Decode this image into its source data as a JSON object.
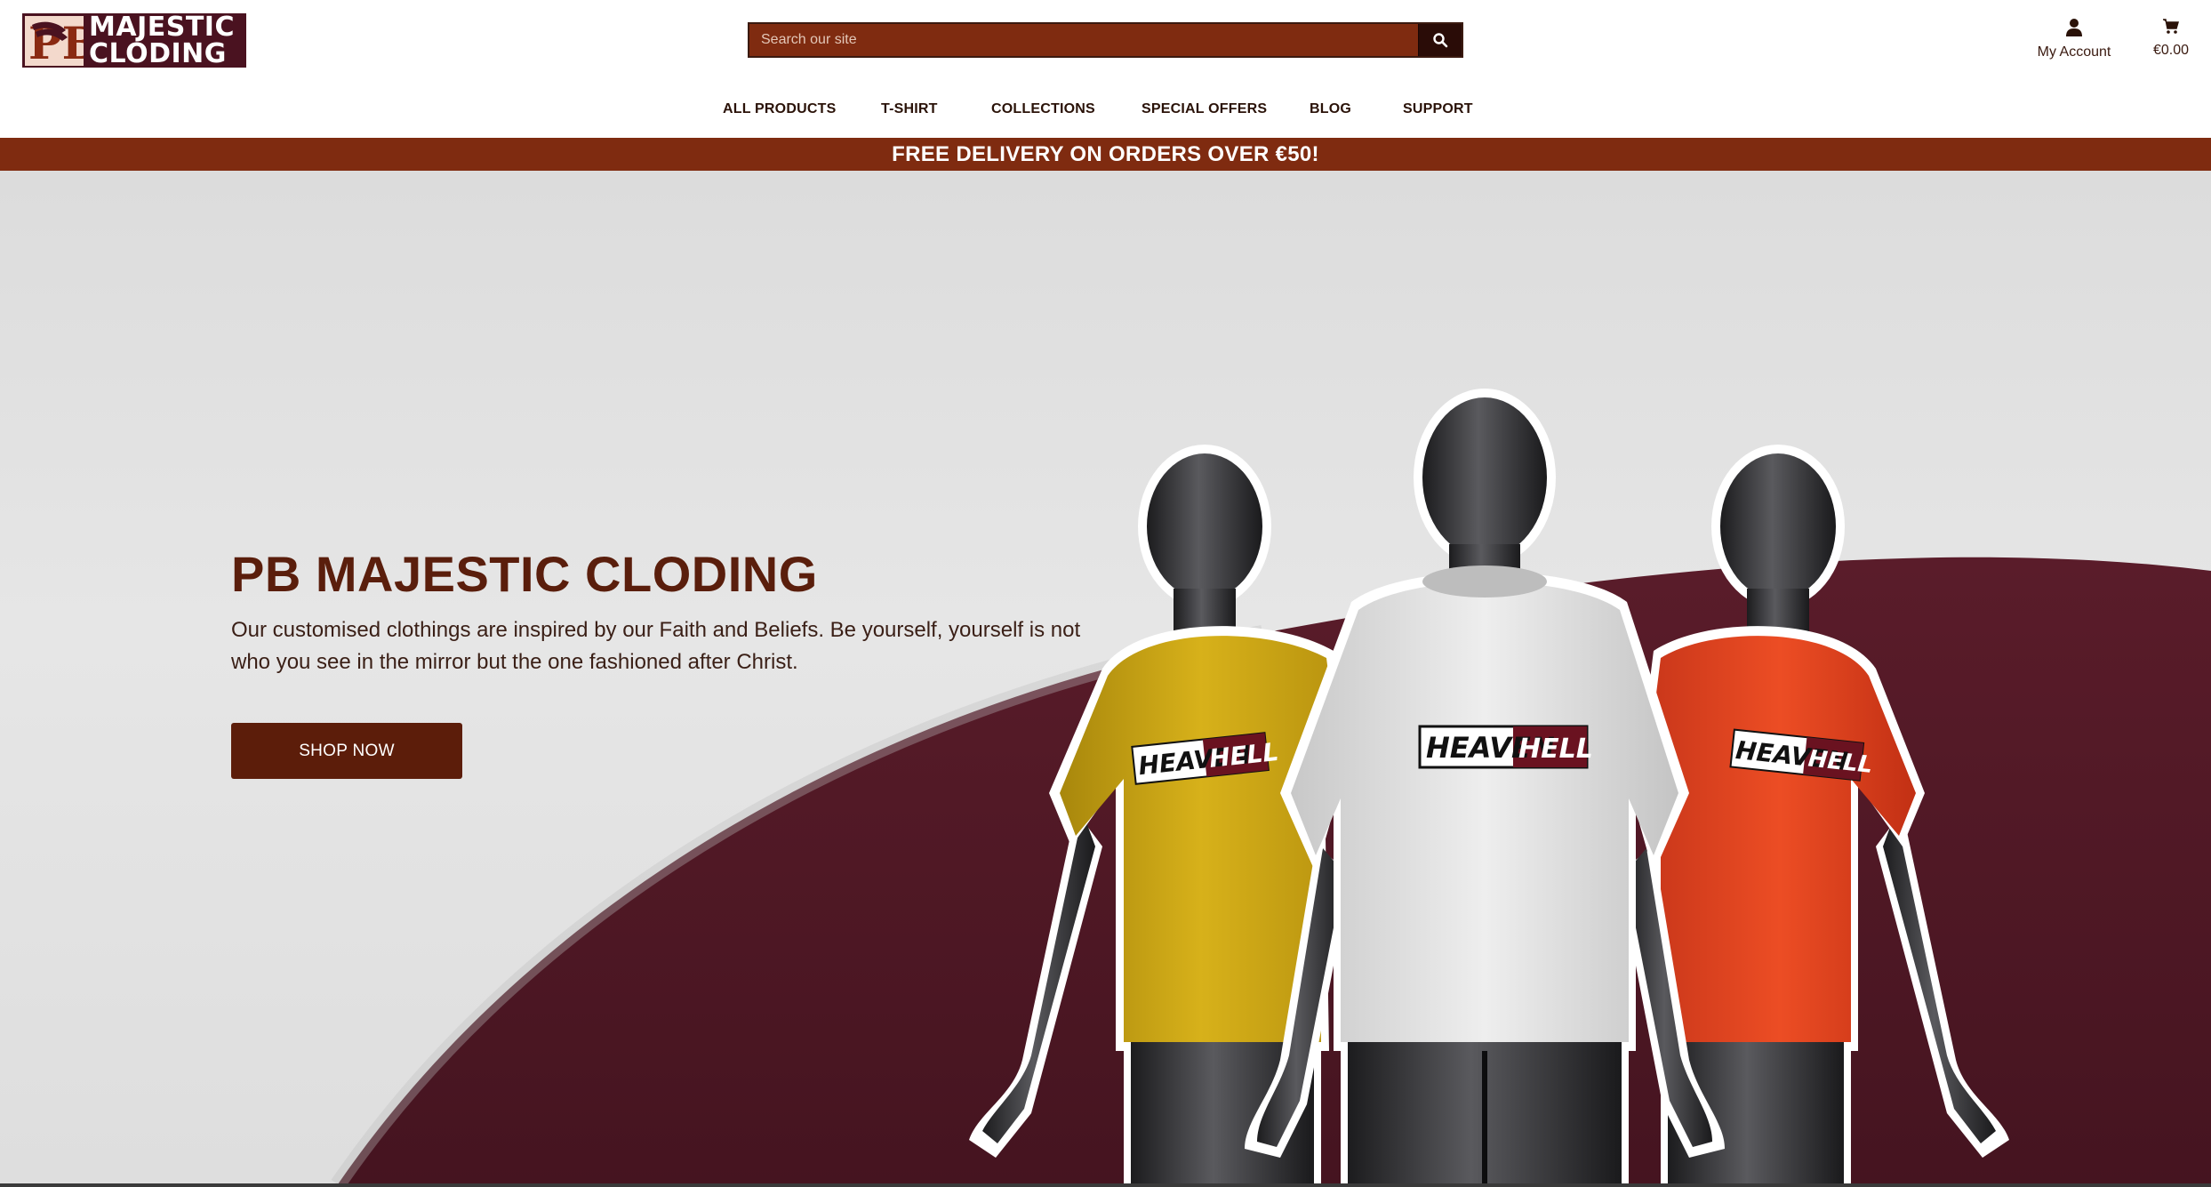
{
  "header": {
    "logo_line1": "MAJESTIC",
    "logo_line2": "CLODING",
    "logo_mark": "PB",
    "search_placeholder": "Search our site",
    "search_icon": "search-icon",
    "account_label": "My Account",
    "account_icon": "user-icon",
    "cart_total": "€0.00",
    "cart_icon": "cart-icon"
  },
  "nav": {
    "items": [
      {
        "label": "ALL PRODUCTS"
      },
      {
        "label": "T-SHIRT"
      },
      {
        "label": "COLLECTIONS"
      },
      {
        "label": "SPECIAL OFFERS"
      },
      {
        "label": "BLOG"
      },
      {
        "label": "SUPPORT"
      }
    ]
  },
  "banner": {
    "text": "FREE DELIVERY ON ORDERS OVER €50!"
  },
  "hero": {
    "title": "PB MAJESTIC CLODING",
    "subtitle": "Our customised clothings are inspired by our Faith and Beliefs. Be yourself, yourself is not who you see in the mirror but the one fashioned after Christ.",
    "cta": "SHOP NOW",
    "shirt_print_left": "HEAVEN",
    "shirt_print_right": "HELL"
  },
  "colors": {
    "brand_dark": "#4a1220",
    "brand_rust": "#7f2b10",
    "wave": "#4e1824",
    "shirt_yellow": "#c9a514",
    "shirt_white": "#dcdcdc",
    "shirt_orange": "#e0431e"
  }
}
